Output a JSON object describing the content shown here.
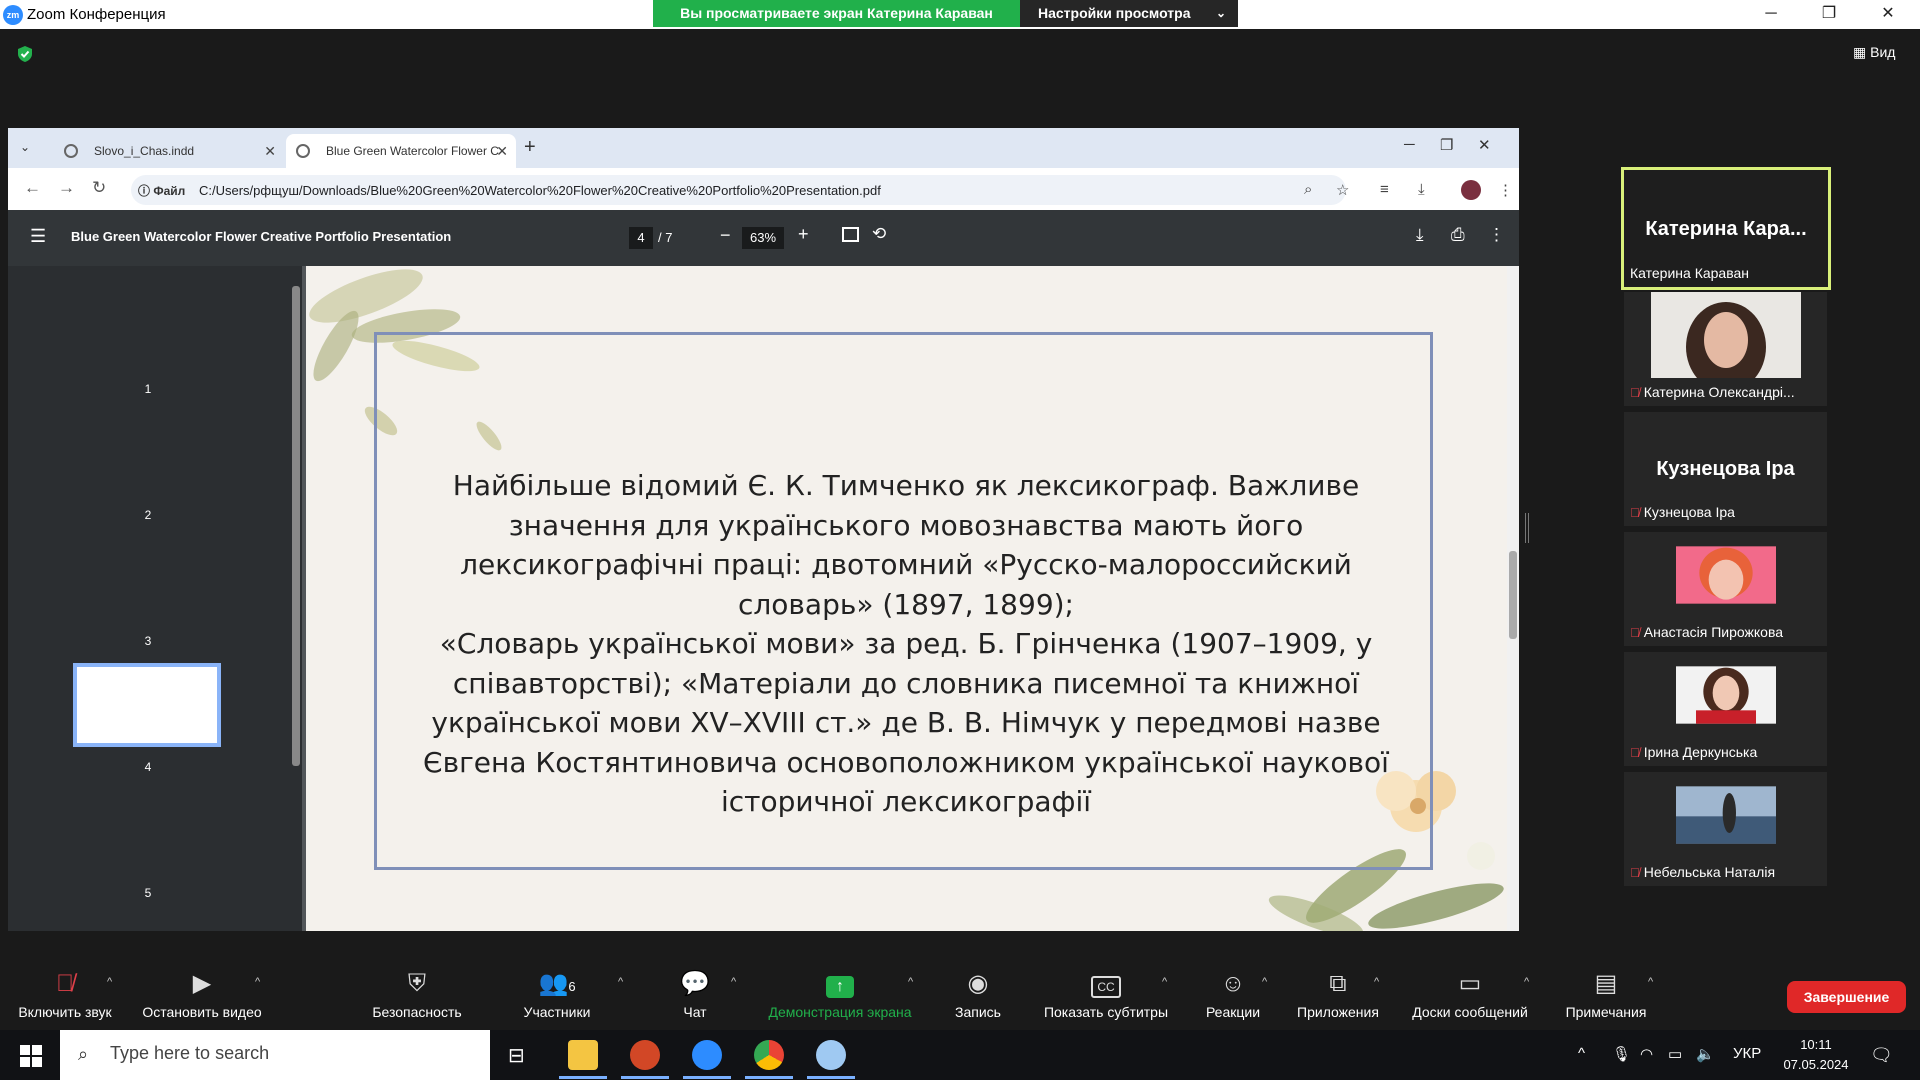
{
  "zoom": {
    "app_title": "Zoom Конференция",
    "logo_text": "zm",
    "share_banner": "Вы просматриваете экран Катерина Караван",
    "view_settings": "Настройки просмотра",
    "view_button": "Вид"
  },
  "browser": {
    "tabs": [
      {
        "label": "Slovo_i_Chas.indd"
      },
      {
        "label": "Blue Green Watercolor Flower C"
      }
    ],
    "file_chip": "Файл",
    "url": "C:/Users/рфщуш/Downloads/Blue%20Green%20Watercolor%20Flower%20Creative%20Portfolio%20Presentation.pdf"
  },
  "pdf": {
    "title": "Blue Green Watercolor Flower Creative Portfolio Presentation",
    "current_page": "4",
    "total_pages": "/ 7",
    "zoom_level": "63%",
    "thumbnails": [
      "1",
      "2",
      "3",
      "4",
      "5"
    ],
    "slide_lines": [
      "Найбільше відомий Є. К. Тимченко як лексикограф. Важливе",
      "значення для українського мовознавства мають його",
      "лексикографічні праці: двотомний «Русско-малороссийский",
      "словарь» (1897, 1899);",
      "«Словарь української мови» за ред. Б. Грінченка (1907–1909, у",
      "співавторстві); «Матеріали до словника писемної та книжної",
      "української мови XV–XVIII ст.»  де В. В. Німчук у передмові назве",
      "Євгена Костянтиновича основоположником української наукової",
      "історичної лексикографії"
    ]
  },
  "participants": {
    "active": {
      "big_name": "Катерина Кара...",
      "label": "Катерина Караван"
    },
    "list": [
      {
        "label": "Катерина Олександрі..."
      },
      {
        "big_name": "Кузнецова Іра",
        "label": "Кузнецова Іра"
      },
      {
        "label": "Анастасія Пирожкова"
      },
      {
        "label": "Ірина Деркунська"
      },
      {
        "label": "Небельська Наталія"
      }
    ]
  },
  "toolbar": {
    "unmute": "Включить звук",
    "stop_video": "Остановить видео",
    "security": "Безопасность",
    "participants": "Участники",
    "participants_count": "6",
    "chat": "Чат",
    "share": "Демонстрация экрана",
    "record": "Запись",
    "captions": "Показать субтитры",
    "reactions": "Реакции",
    "apps": "Приложения",
    "whiteboards": "Доски сообщений",
    "notes": "Примечания",
    "end": "Завершение",
    "share_color": "#21b04b"
  },
  "taskbar": {
    "search_placeholder": "Type here to search",
    "language": "УКР",
    "time": "10:11",
    "date": "07.05.2024"
  }
}
